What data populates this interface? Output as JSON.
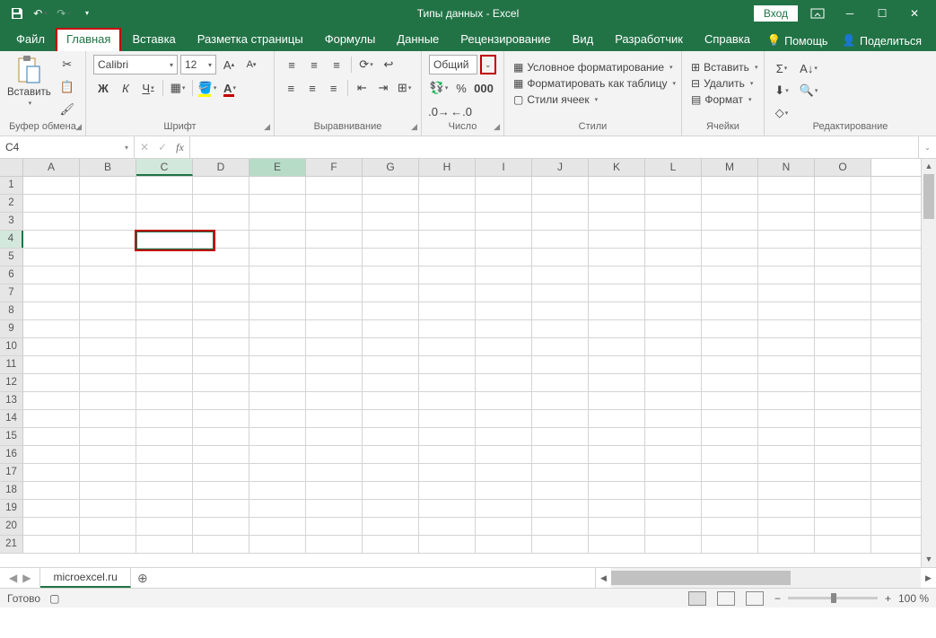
{
  "titlebar": {
    "doc_title": "Типы данных  -  Excel",
    "login": "Вход"
  },
  "tabs": {
    "file": "Файл",
    "home": "Главная",
    "insert": "Вставка",
    "layout": "Разметка страницы",
    "formulas": "Формулы",
    "data": "Данные",
    "review": "Рецензирование",
    "view": "Вид",
    "developer": "Разработчик",
    "help": "Справка",
    "tell_me": "Помощь",
    "share": "Поделиться"
  },
  "ribbon": {
    "clipboard": {
      "paste": "Вставить",
      "label": "Буфер обмена"
    },
    "font": {
      "name": "Calibri",
      "size": "12",
      "label": "Шрифт",
      "bold": "Ж",
      "italic": "К",
      "underline": "Ч"
    },
    "alignment": {
      "label": "Выравнивание"
    },
    "number": {
      "format": "Общий",
      "label": "Число"
    },
    "styles": {
      "cond": "Условное форматирование",
      "table": "Форматировать как таблицу",
      "cell": "Стили ячеек",
      "label": "Стили"
    },
    "cells": {
      "insert": "Вставить",
      "delete": "Удалить",
      "format": "Формат",
      "label": "Ячейки"
    },
    "editing": {
      "label": "Редактирование"
    }
  },
  "namebox": "C4",
  "columns": [
    "A",
    "B",
    "C",
    "D",
    "E",
    "F",
    "G",
    "H",
    "I",
    "J",
    "K",
    "L",
    "M",
    "N",
    "O"
  ],
  "rows": [
    "1",
    "2",
    "3",
    "4",
    "5",
    "6",
    "7",
    "8",
    "9",
    "10",
    "11",
    "12",
    "13",
    "14",
    "15",
    "16",
    "17",
    "18",
    "19",
    "20",
    "21"
  ],
  "selected": {
    "col": "C",
    "row": "4",
    "col_hi": "E"
  },
  "sheet": {
    "name": "microexcel.ru"
  },
  "status": {
    "ready": "Готово",
    "zoom": "100 %"
  }
}
